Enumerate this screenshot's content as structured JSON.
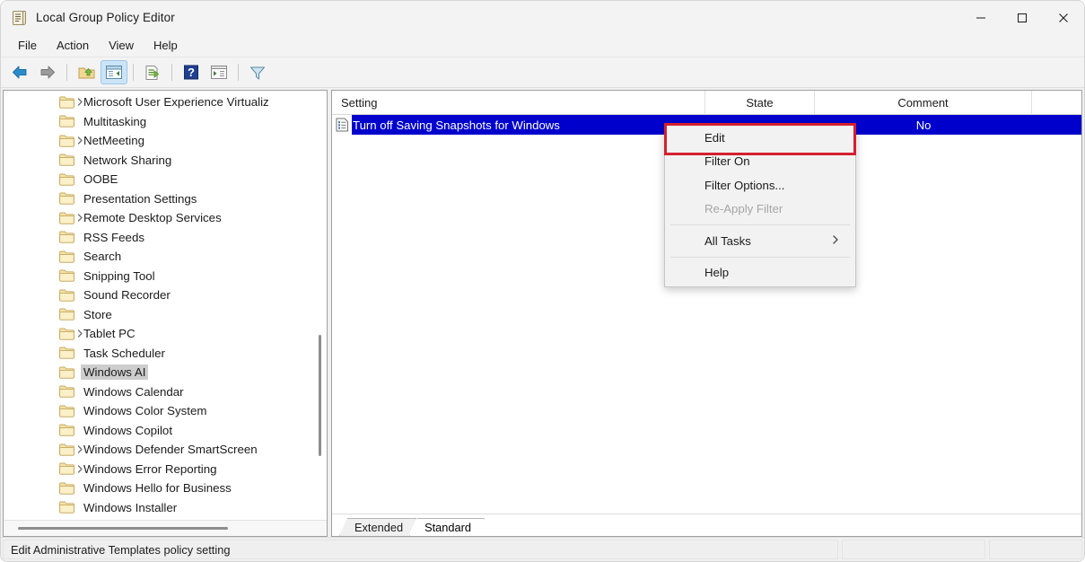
{
  "window": {
    "title": "Local Group Policy Editor",
    "icon": "policy-scroll-icon",
    "minimize_label": "─",
    "maximize_label": "☐",
    "close_label": "✕"
  },
  "menubar": {
    "items": [
      {
        "label": "File"
      },
      {
        "label": "Action"
      },
      {
        "label": "View"
      },
      {
        "label": "Help"
      }
    ]
  },
  "toolbar": {
    "buttons": [
      {
        "name": "back-icon",
        "tip": "Back"
      },
      {
        "name": "forward-icon",
        "tip": "Forward"
      },
      {
        "name": "up-folder-icon",
        "tip": "Up One Level"
      },
      {
        "name": "show-hide-console-tree-icon",
        "tip": "Show/Hide Console Tree",
        "active": true
      },
      {
        "name": "export-list-icon",
        "tip": "Export List"
      },
      {
        "name": "help-icon",
        "tip": "Help"
      },
      {
        "name": "show-hide-action-pane-icon",
        "tip": "Show/Hide Action Pane"
      },
      {
        "name": "filter-icon",
        "tip": "Filter"
      }
    ]
  },
  "tree": {
    "items": [
      {
        "label": "Microsoft User Experience Virtualiz",
        "expandable": true,
        "selected": false
      },
      {
        "label": "Multitasking",
        "expandable": false,
        "selected": false
      },
      {
        "label": "NetMeeting",
        "expandable": true,
        "selected": false
      },
      {
        "label": "Network Sharing",
        "expandable": false,
        "selected": false
      },
      {
        "label": "OOBE",
        "expandable": false,
        "selected": false
      },
      {
        "label": "Presentation Settings",
        "expandable": false,
        "selected": false
      },
      {
        "label": "Remote Desktop Services",
        "expandable": true,
        "selected": false
      },
      {
        "label": "RSS Feeds",
        "expandable": false,
        "selected": false
      },
      {
        "label": "Search",
        "expandable": false,
        "selected": false
      },
      {
        "label": "Snipping Tool",
        "expandable": false,
        "selected": false
      },
      {
        "label": "Sound Recorder",
        "expandable": false,
        "selected": false
      },
      {
        "label": "Store",
        "expandable": false,
        "selected": false
      },
      {
        "label": "Tablet PC",
        "expandable": true,
        "selected": false
      },
      {
        "label": "Task Scheduler",
        "expandable": false,
        "selected": false
      },
      {
        "label": "Windows AI",
        "expandable": false,
        "selected": true
      },
      {
        "label": "Windows Calendar",
        "expandable": false,
        "selected": false
      },
      {
        "label": "Windows Color System",
        "expandable": false,
        "selected": false
      },
      {
        "label": "Windows Copilot",
        "expandable": false,
        "selected": false
      },
      {
        "label": "Windows Defender SmartScreen",
        "expandable": true,
        "selected": false
      },
      {
        "label": "Windows Error Reporting",
        "expandable": true,
        "selected": false
      },
      {
        "label": "Windows Hello for Business",
        "expandable": false,
        "selected": false
      },
      {
        "label": "Windows Installer",
        "expandable": false,
        "selected": false
      }
    ]
  },
  "list": {
    "columns": [
      {
        "label": "Setting"
      },
      {
        "label": "State"
      },
      {
        "label": "Comment"
      }
    ],
    "rows": [
      {
        "setting": "Turn off Saving Snapshots for Windows",
        "state": "",
        "comment": "No",
        "selected": true,
        "icon": "policy-setting-icon"
      }
    ]
  },
  "tabs": [
    {
      "label": "Extended",
      "active": false
    },
    {
      "label": "Standard",
      "active": true
    }
  ],
  "statusbar": {
    "message": "Edit Administrative Templates policy setting",
    "panel2": "",
    "panel3": ""
  },
  "context_menu": {
    "items": [
      {
        "label": "Edit",
        "disabled": false,
        "submenu": false,
        "highlighted": true
      },
      {
        "label": "Filter On",
        "disabled": false,
        "submenu": false,
        "highlighted": false
      },
      {
        "label": "Filter Options...",
        "disabled": false,
        "submenu": false,
        "highlighted": false
      },
      {
        "label": "Re-Apply Filter",
        "disabled": true,
        "submenu": false,
        "highlighted": false
      },
      {
        "separator": true
      },
      {
        "label": "All Tasks",
        "disabled": false,
        "submenu": true,
        "highlighted": false,
        "submenu_arrow": "›"
      },
      {
        "separator": true
      },
      {
        "label": "Help",
        "disabled": false,
        "submenu": false,
        "highlighted": false
      }
    ]
  },
  "colors": {
    "selection_blue": "#0000cd",
    "highlight_red": "#d32030",
    "tree_selection_gray": "#cdcdcd",
    "toolbar_active": "#cce4f7"
  }
}
